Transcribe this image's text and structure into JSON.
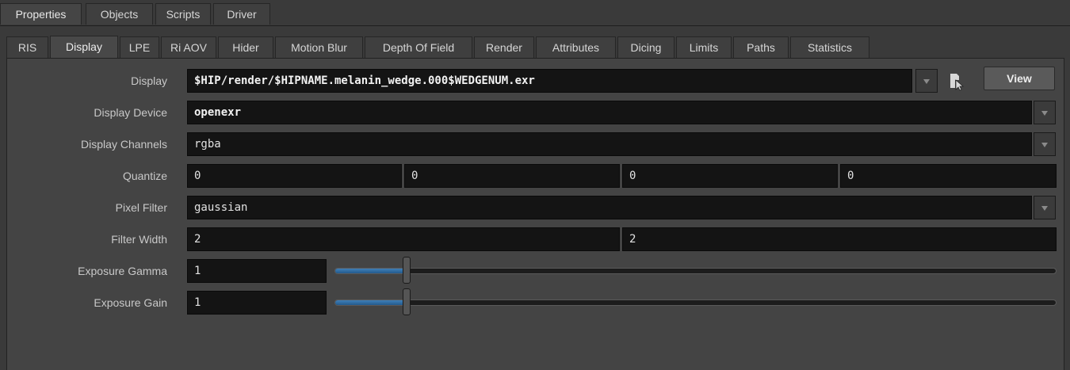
{
  "top_tabs": [
    "Properties",
    "Objects",
    "Scripts",
    "Driver"
  ],
  "sub_tabs": [
    "RIS",
    "Display",
    "LPE",
    "Ri AOV",
    "Hider",
    "Motion Blur",
    "Depth Of Field",
    "Render",
    "Attributes",
    "Dicing",
    "Limits",
    "Paths",
    "Statistics"
  ],
  "active_sub_tab": "Display",
  "params": {
    "display": {
      "label": "Display",
      "value": "$HIP/render/$HIPNAME.melanin_wedge.000$WEDGENUM.exr"
    },
    "view_button": "View",
    "display_device": {
      "label": "Display Device",
      "value": "openexr"
    },
    "display_channels": {
      "label": "Display Channels",
      "value": "rgba"
    },
    "quantize": {
      "label": "Quantize",
      "values": [
        "0",
        "0",
        "0",
        "0"
      ]
    },
    "pixel_filter": {
      "label": "Pixel Filter",
      "value": "gaussian"
    },
    "filter_width": {
      "label": "Filter Width",
      "values": [
        "2",
        "2"
      ]
    },
    "exposure_gamma": {
      "label": "Exposure Gamma",
      "value": "1",
      "slider_fraction": 0.1
    },
    "exposure_gain": {
      "label": "Exposure Gain",
      "value": "1",
      "slider_fraction": 0.1
    }
  },
  "colors": {
    "slider_fill": "#3f7fb8",
    "field_bg": "#141414",
    "panel_bg": "#444444"
  }
}
